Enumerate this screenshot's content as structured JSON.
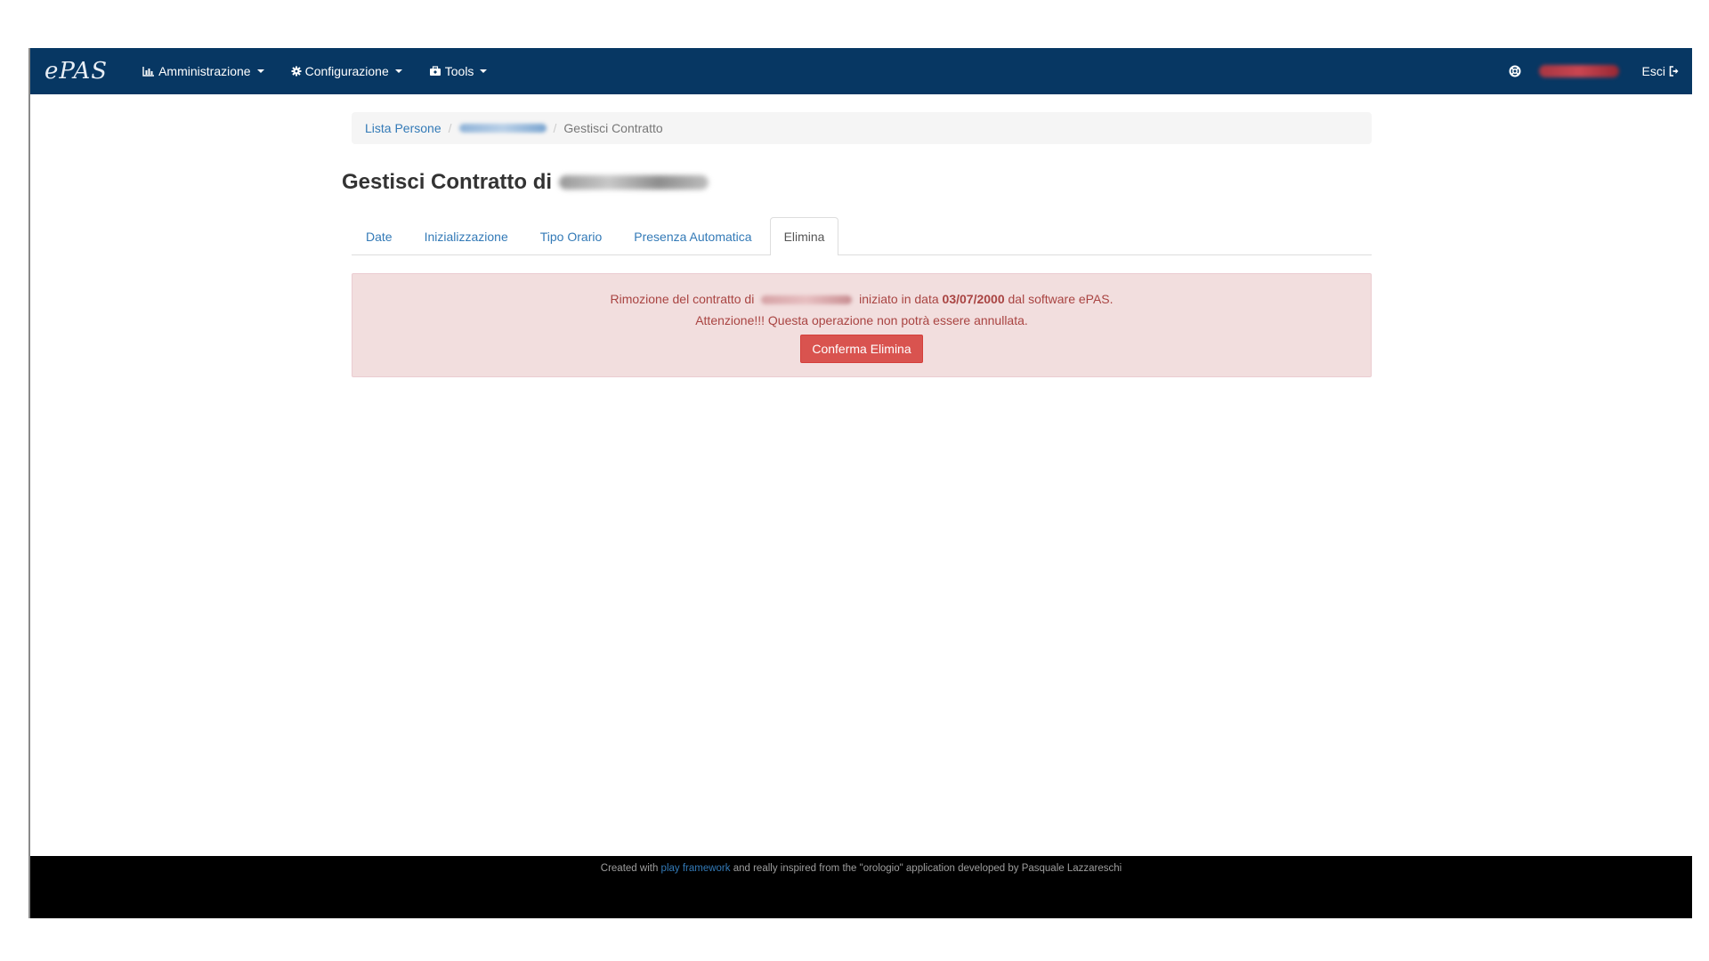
{
  "navbar": {
    "brand": "ePAS",
    "menus": [
      {
        "label": "Amministrazione",
        "icon": "bar-chart-icon"
      },
      {
        "label": "Configurazione",
        "icon": "gear-icon"
      },
      {
        "label": "Tools",
        "icon": "briefcase-icon"
      }
    ],
    "help_icon": "lifebuoy-icon",
    "logout_label": "Esci",
    "logout_icon": "logout-icon"
  },
  "breadcrumb": {
    "first": "Lista Persone",
    "current": "Gestisci Contratto"
  },
  "page": {
    "title_prefix": "Gestisci Contratto di"
  },
  "tabs": [
    {
      "label": "Date",
      "active": false
    },
    {
      "label": "Inizializzazione",
      "active": false
    },
    {
      "label": "Tipo Orario",
      "active": false
    },
    {
      "label": "Presenza Automatica",
      "active": false
    },
    {
      "label": "Elimina",
      "active": true
    }
  ],
  "alert": {
    "line1_before": "Rimozione del contratto di",
    "line1_middle": "iniziato in data",
    "line1_date": "03/07/2000",
    "line1_after": "dal software ePAS.",
    "line2": "Attenzione!!! Questa operazione non potrà essere annullata.",
    "button_label": "Conferma Elimina"
  },
  "footer": {
    "before": "Created with",
    "link": "play framework",
    "after": "and really inspired from the \"orologio\" application developed by Pasquale Lazzareschi"
  },
  "colors": {
    "navbar": "#073763",
    "link": "#337ab7",
    "alert_bg": "#f2dede",
    "alert_text": "#a94442",
    "danger_button": "#d9534f",
    "footer": "#000000"
  }
}
